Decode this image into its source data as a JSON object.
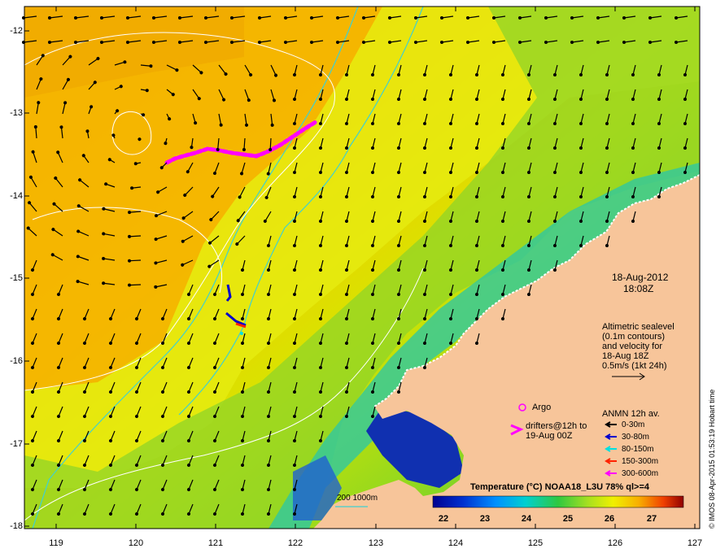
{
  "map": {
    "date_line1": "18-Aug-2012",
    "date_line2": "18:08Z",
    "altimetry": [
      "Altimetric sealevel",
      "(0.1m contours)",
      "and velocity for",
      "18-Aug 18Z",
      "0.5m/s (1kt 24h)"
    ],
    "argo_label": "Argo",
    "drifters": [
      "drifters@12h to",
      "19-Aug 00Z"
    ],
    "anmn_title": "ANMN 12h av.",
    "anmn_depths": [
      {
        "label": "0-30m",
        "color": "#000000"
      },
      {
        "label": "30-80m",
        "color": "#0000cc"
      },
      {
        "label": "80-150m",
        "color": "#00e0e0"
      },
      {
        "label": "150-300m",
        "color": "#ff2200"
      },
      {
        "label": "300-600m",
        "color": "#ff00ff"
      }
    ],
    "colorbar_title": "Temperature (°C) NOAA18_L3U 78% ql>=4",
    "colorbar_ticks": [
      "22",
      "23",
      "24",
      "25",
      "26",
      "27"
    ],
    "isobath_label": "200  1000m",
    "credit": "© IMOS 08-Apr-2015 01:53:19 Hobart time",
    "lat_ticks": [
      "-12",
      "-13",
      "-14",
      "-15",
      "-16",
      "-17",
      "-18"
    ],
    "lon_ticks": [
      "119",
      "120",
      "121",
      "122",
      "123",
      "124",
      "125",
      "126",
      "127"
    ],
    "colors": {
      "land": "#f7c59a",
      "warm": "#f5b800",
      "cool": "#1030b0",
      "isobath": "#40d0d0"
    }
  }
}
